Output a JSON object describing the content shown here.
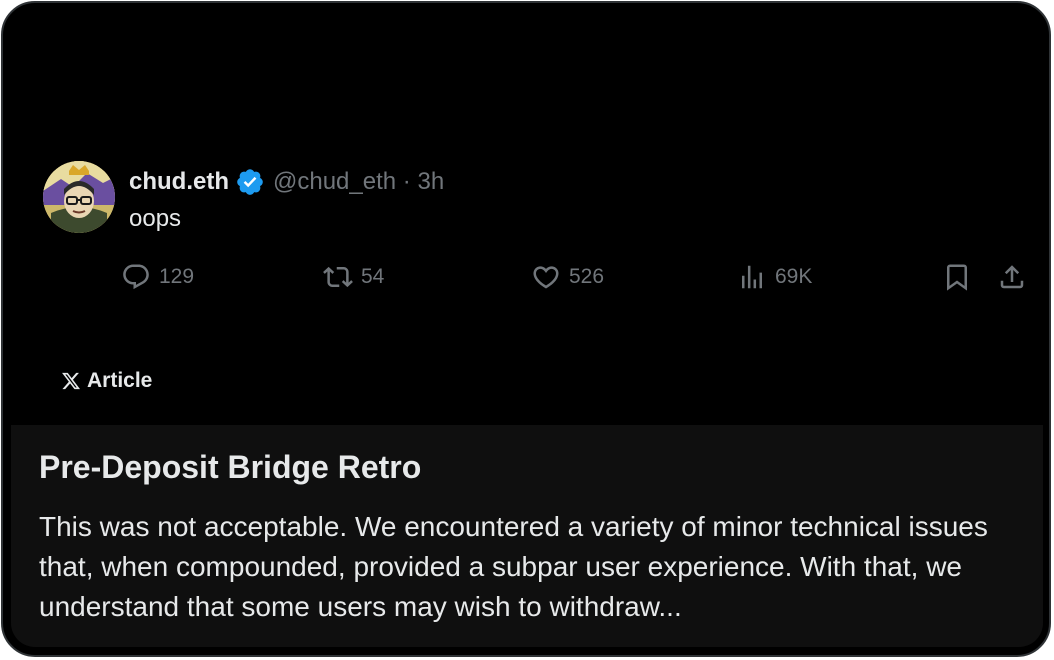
{
  "post": {
    "author": {
      "display_name": "chud.eth",
      "verified_icon": "verified-badge-icon",
      "handle": "@chud_eth",
      "separator": "·",
      "time": "3h"
    },
    "text": "oops",
    "actions": {
      "replies": "129",
      "reposts": "54",
      "likes": "526",
      "views": "69K"
    }
  },
  "article": {
    "label": "Article",
    "title": "Pre-Deposit Bridge Retro",
    "excerpt": "This was not acceptable. We encountered a variety of minor technical issues that, when compounded, provided a subpar user experience. With that, we understand that some users may wish to withdraw..."
  },
  "colors": {
    "background": "#000000",
    "article_bg": "#0f0f0f",
    "text_primary": "#e7e9ea",
    "text_secondary": "#71767b",
    "verified_blue": "#1d9bf0"
  }
}
